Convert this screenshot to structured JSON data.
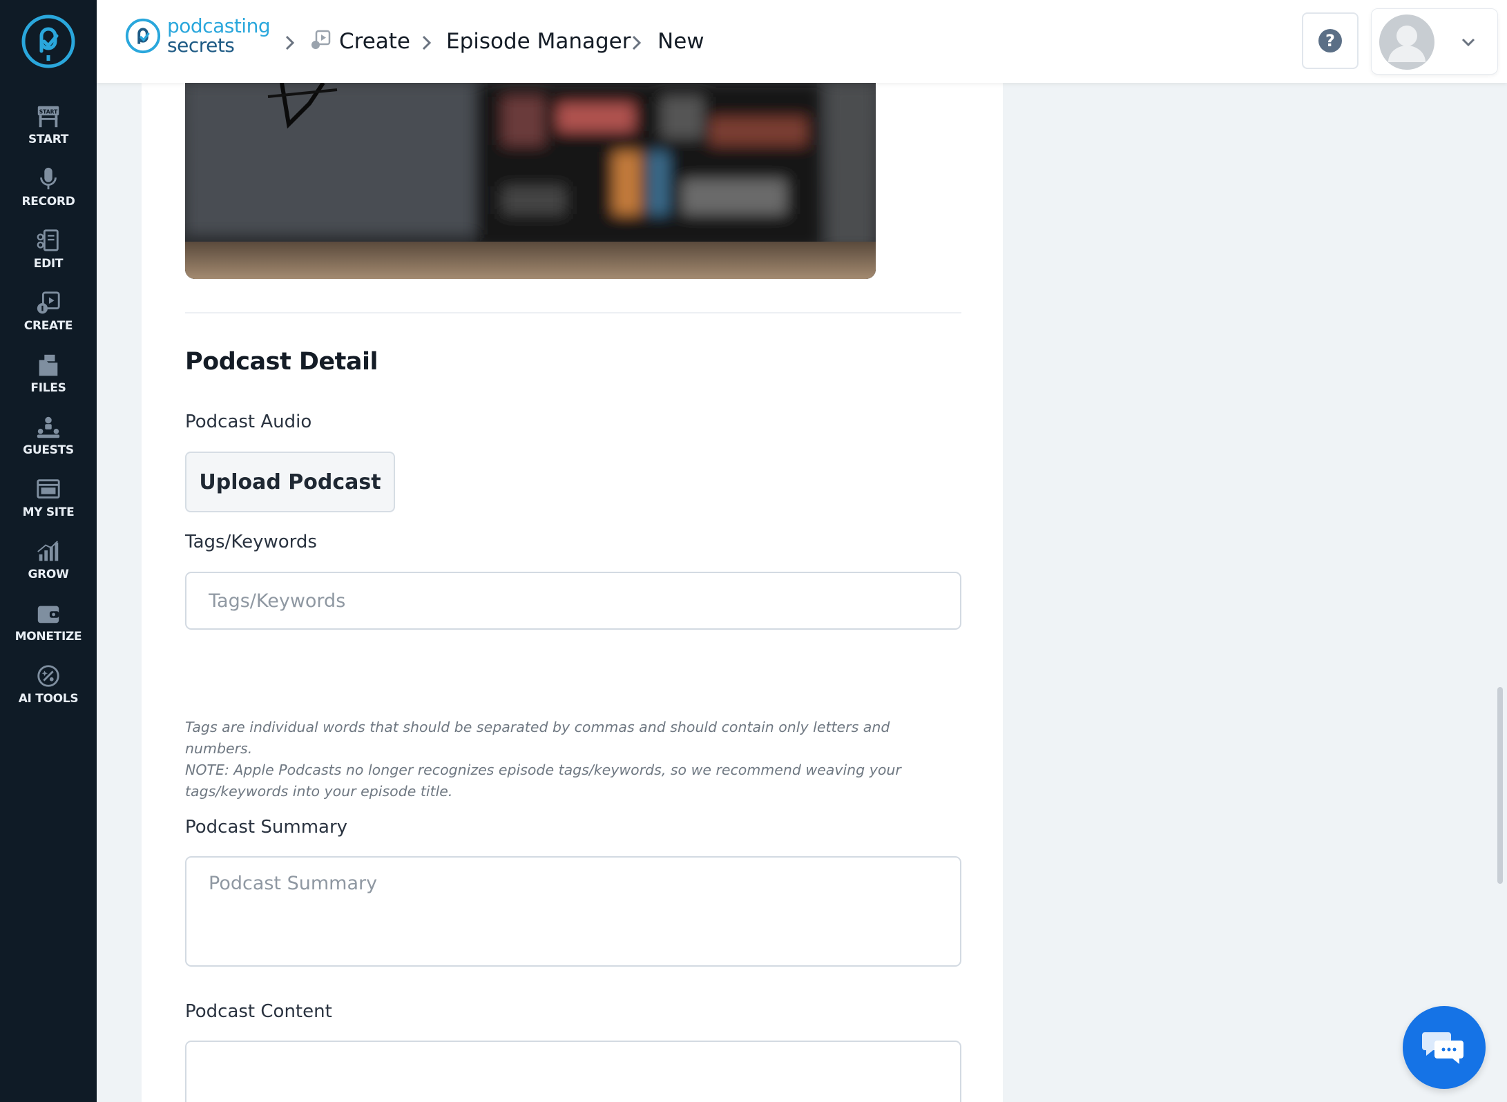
{
  "sidebar": {
    "items": [
      {
        "label": "START",
        "icon": "start-sign-icon"
      },
      {
        "label": "RECORD",
        "icon": "microphone-icon"
      },
      {
        "label": "EDIT",
        "icon": "edit-document-icon"
      },
      {
        "label": "CREATE",
        "icon": "create-media-icon"
      },
      {
        "label": "FILES",
        "icon": "files-icon"
      },
      {
        "label": "GUESTS",
        "icon": "guests-icon"
      },
      {
        "label": "MY SITE",
        "icon": "website-icon"
      },
      {
        "label": "GROW",
        "icon": "growth-chart-icon"
      },
      {
        "label": "MONETIZE",
        "icon": "wallet-icon"
      },
      {
        "label": "AI TOOLS",
        "icon": "ai-tools-icon"
      }
    ]
  },
  "header": {
    "brand_line1": "podcasting",
    "brand_line2": "secrets",
    "breadcrumb": [
      "Create",
      "Episode Manager",
      "New"
    ]
  },
  "form": {
    "section_title": "Podcast Detail",
    "audio_label": "Podcast Audio",
    "upload_button": "Upload Podcast",
    "tags_label": "Tags/Keywords",
    "tags_placeholder": "Tags/Keywords",
    "tags_help_line1": "Tags are individual words that should be separated by commas and should contain only letters and numbers.",
    "tags_help_line2": "NOTE: Apple Podcasts no longer recognizes episode tags/keywords, so we recommend weaving your",
    "tags_help_line3": "tags/keywords into your episode title.",
    "summary_label": "Podcast Summary",
    "summary_placeholder": "Podcast Summary",
    "content_label": "Podcast Content"
  },
  "colors": {
    "sidebar_bg": "#0f1b26",
    "accent": "#2aa7dc",
    "chat_button": "#1573e6"
  }
}
